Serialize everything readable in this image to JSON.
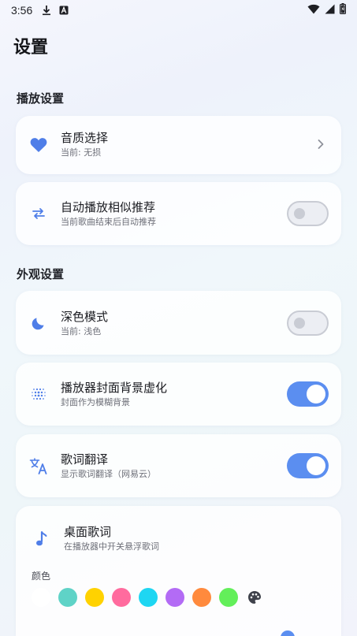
{
  "status": {
    "time": "3:56",
    "icons": [
      "download-icon",
      "a-notification-icon",
      "wifi-icon",
      "signal-icon",
      "battery-icon"
    ]
  },
  "page": {
    "title": "设置"
  },
  "sections": {
    "playback": "播放设置",
    "appearance": "外观设置"
  },
  "items": {
    "quality": {
      "icon": "heart-icon",
      "title": "音质选择",
      "subtitle": "当前: 无损"
    },
    "autoplay": {
      "icon": "swap-arrows-icon",
      "title": "自动播放相似推荐",
      "subtitle": "当前歌曲结束后自动推荐",
      "enabled": false
    },
    "dark_mode": {
      "icon": "moon-icon",
      "title": "深色模式",
      "subtitle": "当前: 浅色",
      "enabled": false
    },
    "blur_cover": {
      "icon": "blur-dots-icon",
      "title": "播放器封面背景虚化",
      "subtitle": "封面作为模糊背景",
      "enabled": true
    },
    "translate": {
      "icon": "translate-icon",
      "title": "歌词翻译",
      "subtitle": "显示歌词翻译（网易云）",
      "enabled": true
    },
    "desktop_lyrics": {
      "icon": "music-note-icon",
      "title": "桌面歌词",
      "subtitle": "在播放器中开关悬浮歌词",
      "color_label": "颜色",
      "colors": [
        "#ffffff",
        "#5fd3c7",
        "#ffd200",
        "#ff6b9e",
        "#1ed6f2",
        "#b36bf5",
        "#ff8a3d",
        "#63ef5a"
      ],
      "palette_icon": "palette-icon"
    }
  },
  "theme": {
    "accent": "#5b8ef0",
    "icon_blue": "#4f7ee8"
  }
}
